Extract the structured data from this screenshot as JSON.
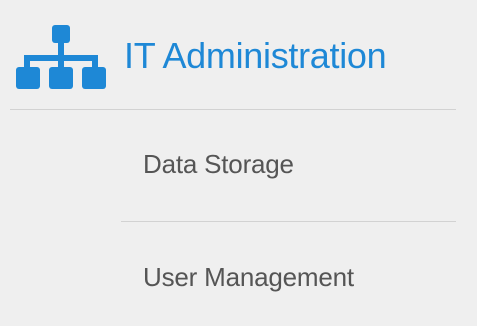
{
  "colors": {
    "background": "#efefef",
    "accent": "#1e88d6",
    "text": "#555555",
    "divider": "#d2d2d2"
  },
  "header": {
    "icon": "sitemap-icon",
    "title": "IT Administration"
  },
  "nav": {
    "items": [
      {
        "label": "Data Storage"
      },
      {
        "label": "User Management"
      }
    ]
  }
}
